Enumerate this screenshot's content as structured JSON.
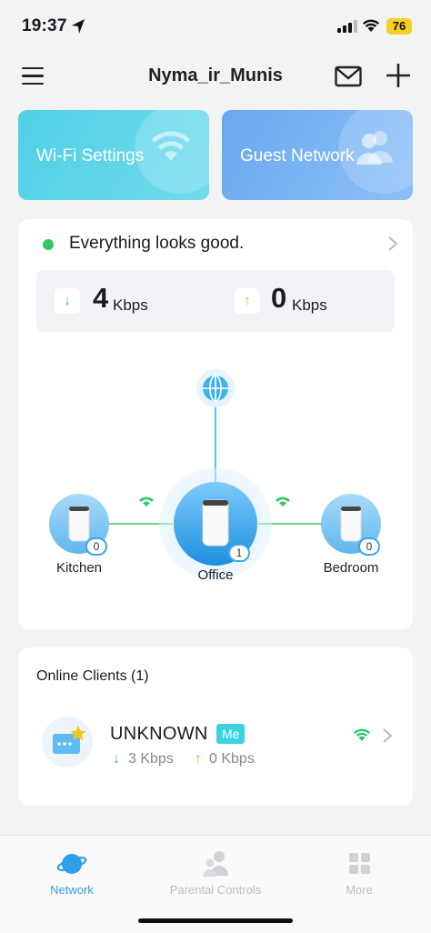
{
  "status_bar": {
    "time": "19:37",
    "battery": "76"
  },
  "header": {
    "title": "Nyma_ir_Munis"
  },
  "quick_cards": {
    "wifi_settings": "Wi-Fi Settings",
    "guest_network": "Guest Network"
  },
  "network": {
    "status": "Everything looks good.",
    "download": {
      "value": "4",
      "unit": "Kbps"
    },
    "upload": {
      "value": "0",
      "unit": "Kbps"
    },
    "nodes": [
      {
        "name": "Kitchen",
        "clients": "0"
      },
      {
        "name": "Office",
        "clients": "1"
      },
      {
        "name": "Bedroom",
        "clients": "0"
      }
    ]
  },
  "clients": {
    "title": "Online Clients (1)",
    "items": [
      {
        "name": "UNKNOWN",
        "badge": "Me",
        "download": "3 Kbps",
        "upload": "0 Kbps"
      }
    ]
  },
  "tabs": [
    {
      "label": "Network",
      "active": true
    },
    {
      "label": "Parental Controls",
      "active": false
    },
    {
      "label": "More",
      "active": false
    }
  ],
  "colors": {
    "accent": "#2f9ee8",
    "status_ok": "#2ec866",
    "wifi_card": "#5ad3e8",
    "guest_card": "#7bb6f3"
  }
}
